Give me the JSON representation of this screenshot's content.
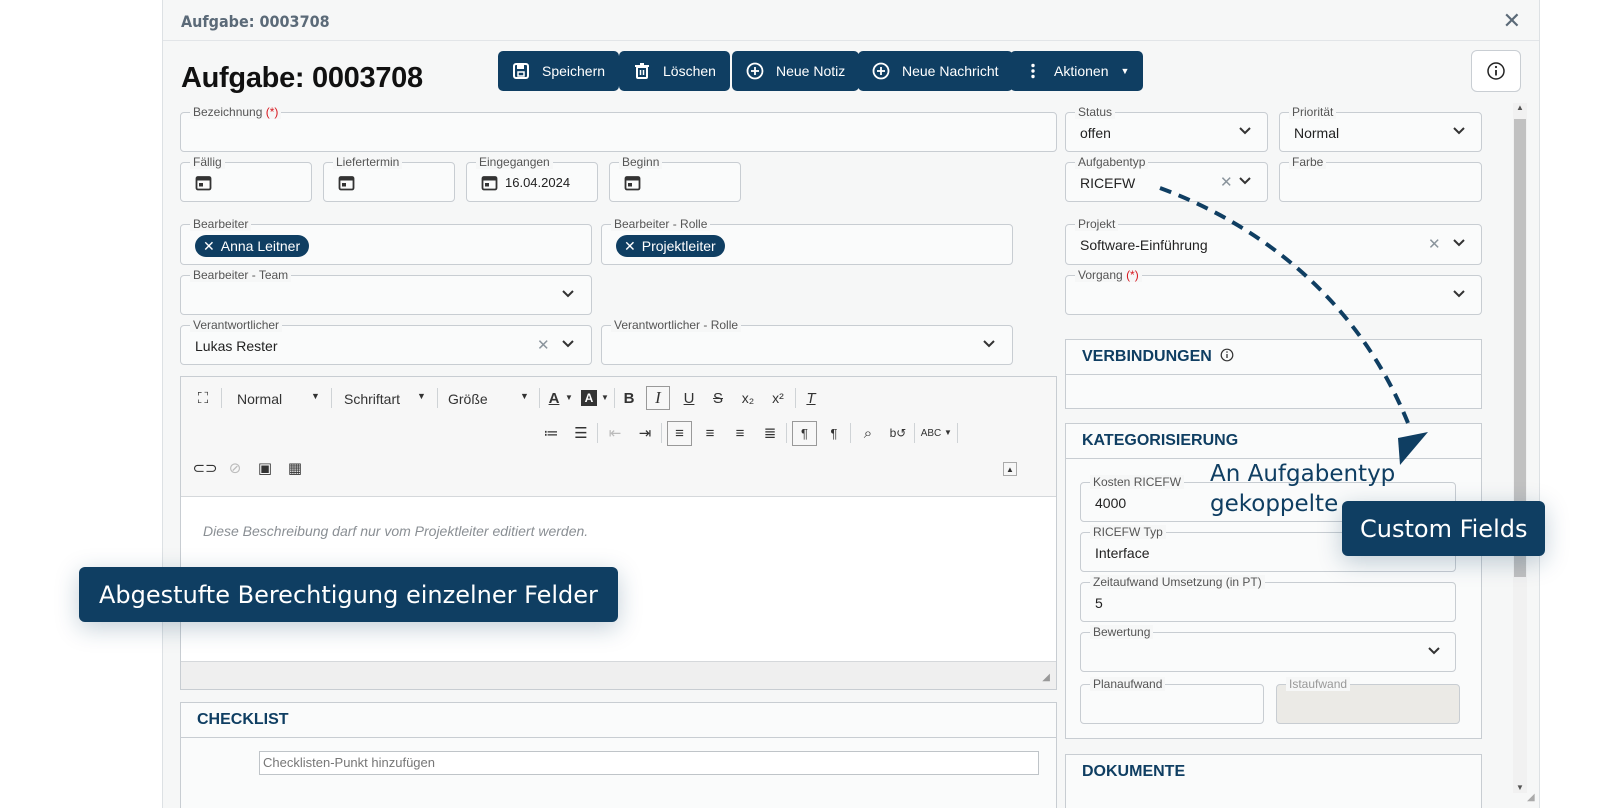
{
  "window": {
    "title": "Aufgabe: 0003708",
    "heading": "Aufgabe: 0003708"
  },
  "toolbar": {
    "save": "Speichern",
    "delete": "Löschen",
    "new_note": "Neue Notiz",
    "new_message": "Neue Nachricht",
    "actions": "Aktionen"
  },
  "form": {
    "bezeichnung": {
      "label": "Bezeichnung",
      "required": "(*)",
      "value": ""
    },
    "faellig": {
      "label": "Fällig",
      "value": ""
    },
    "liefertermin": {
      "label": "Liefertermin",
      "value": ""
    },
    "eingegangen": {
      "label": "Eingegangen",
      "value": "16.04.2024"
    },
    "beginn": {
      "label": "Beginn",
      "value": ""
    },
    "bearbeiter": {
      "label": "Bearbeiter",
      "chip": "Anna Leitner"
    },
    "bearbeiter_rolle": {
      "label": "Bearbeiter - Rolle",
      "chip": "Projektleiter"
    },
    "bearbeiter_team": {
      "label": "Bearbeiter - Team",
      "value": ""
    },
    "verantwortlicher": {
      "label": "Verantwortlicher",
      "value": "Lukas Rester"
    },
    "verantwortlicher_rolle": {
      "label": "Verantwortlicher - Rolle",
      "value": ""
    },
    "status": {
      "label": "Status",
      "value": "offen"
    },
    "prioritaet": {
      "label": "Priorität",
      "value": "Normal"
    },
    "aufgabentyp": {
      "label": "Aufgabentyp",
      "value": "RICEFW"
    },
    "farbe": {
      "label": "Farbe",
      "value": ""
    },
    "projekt": {
      "label": "Projekt",
      "value": "Software-Einführung"
    },
    "vorgang": {
      "label": "Vorgang",
      "required": "(*)",
      "value": ""
    }
  },
  "editor": {
    "format": "Normal",
    "font": "Schriftart",
    "size": "Größe",
    "placeholder": "Diese Beschreibung darf nur vom Projektleiter editiert werden."
  },
  "checklist": {
    "title": "CHECKLIST",
    "placeholder": "Checklisten-Punkt hinzufügen"
  },
  "verbindungen": {
    "title": "VERBINDUNGEN"
  },
  "kategorisierung": {
    "title": "KATEGORISIERUNG",
    "kosten": {
      "label": "Kosten RICEFW",
      "value": "4000"
    },
    "ricefw_typ": {
      "label": "RICEFW Typ",
      "value": "Interface"
    },
    "zeitaufwand": {
      "label": "Zeitaufwand Umsetzung (in PT)",
      "value": "5"
    },
    "bewertung": {
      "label": "Bewertung",
      "value": ""
    },
    "planaufwand": {
      "label": "Planaufwand",
      "value": ""
    },
    "istaufwand": {
      "label": "Istaufwand",
      "value": ""
    }
  },
  "dokumente": {
    "title": "DOKUMENTE"
  },
  "annotations": {
    "berechtigung": "Abgestufte Berechtigung einzelner Felder",
    "gekoppelt_line1": "An Aufgabentyp",
    "gekoppelt_line2": "gekoppelte",
    "custom_fields": "Custom Fields"
  },
  "colors": {
    "primary": "#0f3e62",
    "required": "#d71920",
    "background": "#f6f7f7"
  }
}
